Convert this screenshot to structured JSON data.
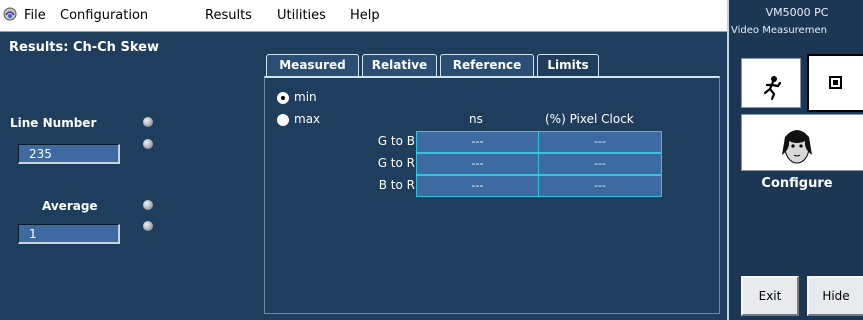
{
  "menu": {
    "items": [
      "File",
      "Configuration",
      "Results",
      "Utilities",
      "Help"
    ]
  },
  "left": {
    "title": "Results: Ch-Ch Skew",
    "line_number_label": "Line Number",
    "line_number_value": "235",
    "average_label": "Average",
    "average_value": "1"
  },
  "tabs": [
    "Measured",
    "Relative",
    "Reference",
    "Limits"
  ],
  "active_tab": "Limits",
  "radio": {
    "min_label": "min",
    "max_label": "max",
    "selected": "min"
  },
  "table": {
    "columns": [
      "ns",
      "(%) Pixel Clock"
    ],
    "rows": [
      {
        "label": "G to B",
        "values": [
          "---",
          "---"
        ]
      },
      {
        "label": "G to R",
        "values": [
          "---",
          "---"
        ]
      },
      {
        "label": "B to R",
        "values": [
          "---",
          "---"
        ]
      }
    ]
  },
  "right": {
    "title": "VM5000 PC",
    "subtitle": "Video Measuremen",
    "configure_label": "Configure",
    "exit_label": "Exit",
    "hide_label": "Hide"
  },
  "colors": {
    "background": "#1f3d5c",
    "field": "#3d6aa0",
    "cell_border": "#33c4de"
  }
}
